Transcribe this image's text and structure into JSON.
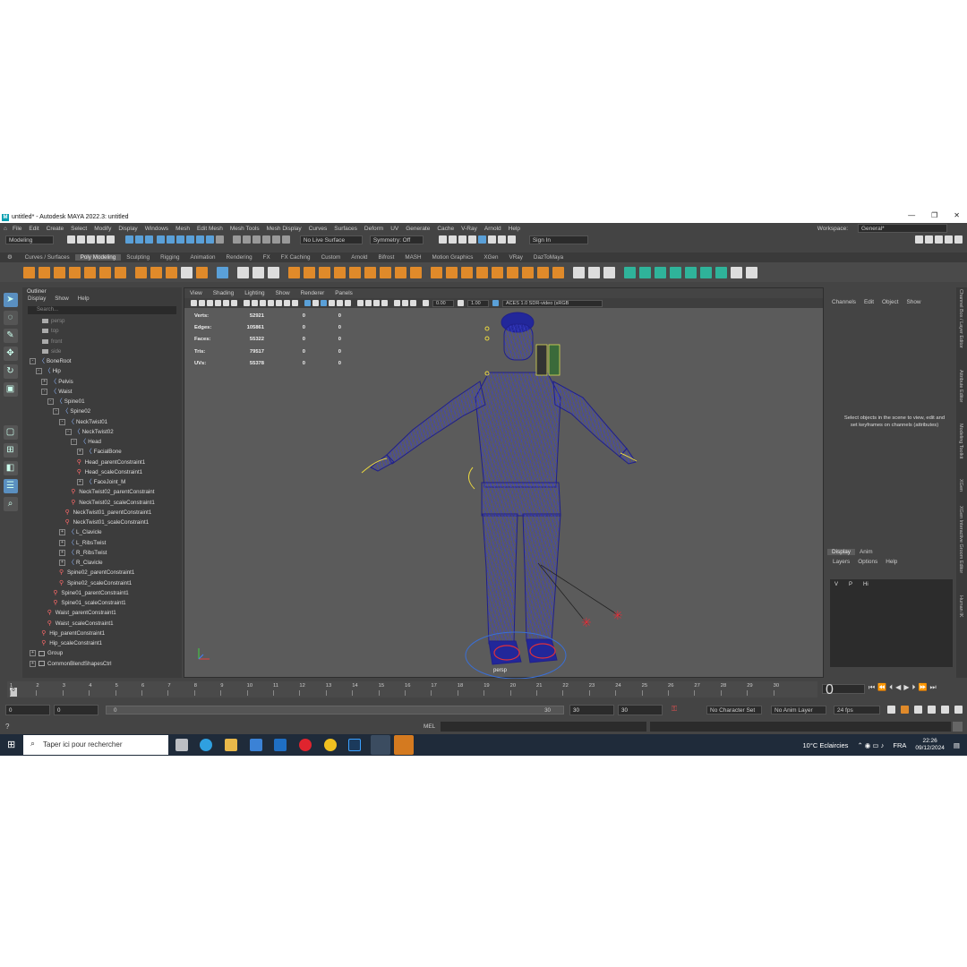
{
  "window": {
    "title": "untitled* - Autodesk MAYA 2022.3: untitled",
    "logo": "M"
  },
  "menubar": {
    "items": [
      "File",
      "Edit",
      "Create",
      "Select",
      "Modify",
      "Display",
      "Windows",
      "Mesh",
      "Edit Mesh",
      "Mesh Tools",
      "Mesh Display",
      "Curves",
      "Surfaces",
      "Deform",
      "UV",
      "Generate",
      "Cache",
      "V-Ray",
      "Arnold",
      "Help"
    ],
    "workspace_label": "Workspace:",
    "workspace_value": "General*"
  },
  "statusline": {
    "mode": "Modeling",
    "live_surface": "No Live Surface",
    "symmetry": "Symmetry: Off",
    "sign_in": "Sign In"
  },
  "shelf": {
    "tabs": [
      "Curves / Surfaces",
      "Poly Modeling",
      "Sculpting",
      "Rigging",
      "Animation",
      "Rendering",
      "FX",
      "FX Caching",
      "Custom",
      "Arnold",
      "Bifrost",
      "MASH",
      "Motion Graphics",
      "XGen",
      "VRay",
      "DazToMaya"
    ],
    "active_tab": "Poly Modeling"
  },
  "outliner": {
    "title": "Outliner",
    "menu": [
      "Display",
      "Show",
      "Help"
    ],
    "search_placeholder": "Search...",
    "nodes": [
      {
        "label": "persp",
        "type": "camera",
        "depth": 0,
        "dim": true
      },
      {
        "label": "top",
        "type": "camera",
        "depth": 0,
        "dim": true
      },
      {
        "label": "front",
        "type": "camera",
        "depth": 0,
        "dim": true
      },
      {
        "label": "side",
        "type": "camera",
        "depth": 0,
        "dim": true
      },
      {
        "label": "BoneRoot",
        "type": "bone",
        "depth": 0,
        "exp": "-"
      },
      {
        "label": "Hip",
        "type": "bone",
        "depth": 1,
        "exp": "-"
      },
      {
        "label": "Pelvis",
        "type": "bone",
        "depth": 2,
        "exp": "+"
      },
      {
        "label": "Waist",
        "type": "bone",
        "depth": 2,
        "exp": "-"
      },
      {
        "label": "Spine01",
        "type": "bone",
        "depth": 3,
        "exp": "-"
      },
      {
        "label": "Spine02",
        "type": "bone",
        "depth": 4,
        "exp": "-"
      },
      {
        "label": "NeckTwist01",
        "type": "bone",
        "depth": 5,
        "exp": "-"
      },
      {
        "label": "NeckTwist02",
        "type": "bone",
        "depth": 6,
        "exp": "-"
      },
      {
        "label": "Head",
        "type": "bone",
        "depth": 7,
        "exp": "-"
      },
      {
        "label": "FacialBone",
        "type": "bone",
        "depth": 8,
        "exp": "+"
      },
      {
        "label": "Head_parentConstraint1",
        "type": "constraint",
        "depth": 8
      },
      {
        "label": "Head_scaleConstraint1",
        "type": "constraint",
        "depth": 8
      },
      {
        "label": "FaceJoint_M",
        "type": "bone",
        "depth": 8,
        "exp": "+"
      },
      {
        "label": "NeckTwist02_parentConstraint",
        "type": "constraint",
        "depth": 7
      },
      {
        "label": "NeckTwist02_scaleConstraint1",
        "type": "constraint",
        "depth": 7
      },
      {
        "label": "NeckTwist01_parentConstraint1",
        "type": "constraint",
        "depth": 6
      },
      {
        "label": "NeckTwist01_scaleConstraint1",
        "type": "constraint",
        "depth": 6
      },
      {
        "label": "L_Clavicle",
        "type": "bone",
        "depth": 5,
        "exp": "+"
      },
      {
        "label": "L_RibsTwist",
        "type": "bone",
        "depth": 5,
        "exp": "+"
      },
      {
        "label": "R_RibsTwist",
        "type": "bone",
        "depth": 5,
        "exp": "+"
      },
      {
        "label": "R_Clavicle",
        "type": "bone",
        "depth": 5,
        "exp": "+"
      },
      {
        "label": "Spine02_parentConstraint1",
        "type": "constraint",
        "depth": 5
      },
      {
        "label": "Spine02_scaleConstraint1",
        "type": "constraint",
        "depth": 5
      },
      {
        "label": "Spine01_parentConstraint1",
        "type": "constraint",
        "depth": 4
      },
      {
        "label": "Spine01_scaleConstraint1",
        "type": "constraint",
        "depth": 4
      },
      {
        "label": "Waist_parentConstraint1",
        "type": "constraint",
        "depth": 3
      },
      {
        "label": "Waist_scaleConstraint1",
        "type": "constraint",
        "depth": 3
      },
      {
        "label": "Hip_parentConstraint1",
        "type": "constraint",
        "depth": 2
      },
      {
        "label": "Hip_scaleConstraint1",
        "type": "constraint",
        "depth": 2
      },
      {
        "label": "Group",
        "type": "group",
        "depth": 0,
        "exp": "+"
      },
      {
        "label": "CommonBlendShapesCtrl",
        "type": "group",
        "depth": 0,
        "exp": "+"
      }
    ]
  },
  "viewport": {
    "menu": [
      "View",
      "Shading",
      "Lighting",
      "Show",
      "Renderer",
      "Panels"
    ],
    "field1": "0.00",
    "field2": "1.00",
    "colorspace": "ACES 1.0 SDR-video (sRGB",
    "camera": "persp",
    "hud": [
      {
        "label": "Verts:",
        "a": "52921",
        "b": "0",
        "c": "0"
      },
      {
        "label": "Edges:",
        "a": "105861",
        "b": "0",
        "c": "0"
      },
      {
        "label": "Faces:",
        "a": "55322",
        "b": "0",
        "c": "0"
      },
      {
        "label": "Tris:",
        "a": "79517",
        "b": "0",
        "c": "0"
      },
      {
        "label": "UVs:",
        "a": "55378",
        "b": "0",
        "c": "0"
      }
    ]
  },
  "channelbox": {
    "menu": [
      "Channels",
      "Edit",
      "Object",
      "Show"
    ],
    "hint": "Select objects in the scene to view, edit and set keyframes on channels (attributes)"
  },
  "layers": {
    "tabs": [
      "Display",
      "Anim"
    ],
    "menu": [
      "Layers",
      "Options",
      "Help"
    ],
    "row": {
      "v": "V",
      "p": "P",
      "name": "Hi"
    }
  },
  "sidetabs": [
    "Channel Box / Layer Editor",
    "Attribute Editor",
    "Modeling Toolkit",
    "XGen",
    "XGen Interactive Groom Editor",
    "Human IK"
  ],
  "timeline": {
    "ticks": [
      "1",
      "2",
      "3",
      "4",
      "5",
      "6",
      "7",
      "8",
      "9",
      "10",
      "11",
      "12",
      "13",
      "14",
      "15",
      "16",
      "17",
      "18",
      "19",
      "20",
      "21",
      "22",
      "23",
      "24",
      "25",
      "26",
      "27",
      "28",
      "29",
      "30"
    ],
    "current_frame": "0",
    "start_marker": "0"
  },
  "range": {
    "start": "0",
    "playback_start": "0",
    "slider_start": "0",
    "slider_end": "30",
    "playback_end": "30",
    "end": "30",
    "character_set": "No Character Set",
    "anim_layer": "No Anim Layer",
    "fps": "24 fps"
  },
  "mel": {
    "label": "MEL"
  },
  "taskbar": {
    "search": "Taper ici pour rechercher",
    "weather": "10°C  Eclaircies",
    "lang": "FRA",
    "time": "22:26",
    "date": "09/12/2024"
  }
}
